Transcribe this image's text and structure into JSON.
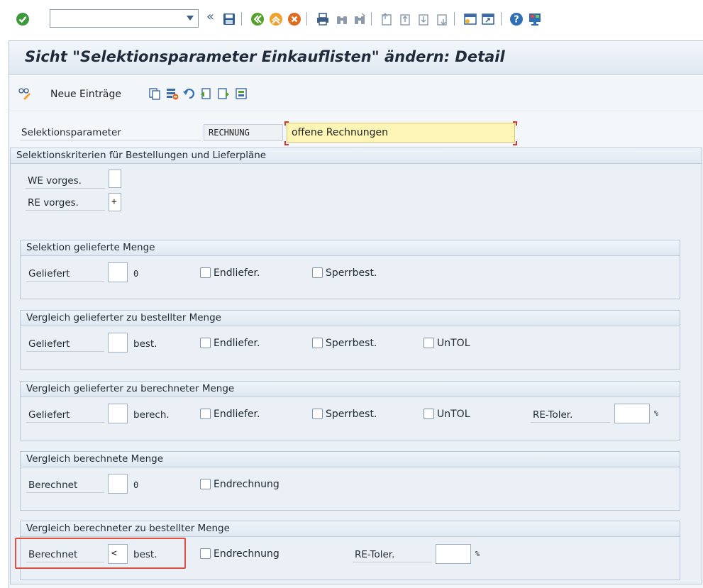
{
  "toolbar": {
    "command_value": "",
    "icons": [
      "enter-icon",
      "command-dropdown-icon",
      "collapse-icon",
      "save-icon",
      "back-icon",
      "exit-icon",
      "cancel-icon",
      "print-icon",
      "find-icon",
      "find-next-icon",
      "first-page-icon",
      "prev-page-icon",
      "next-page-icon",
      "last-page-icon",
      "new-session-icon",
      "shortcut-icon",
      "help-icon",
      "customize-layout-icon"
    ]
  },
  "title": "Sicht \"Selektionsparameter  Einkauflisten\" ändern: Detail",
  "app_toolbar": {
    "new_entries_label": "Neue Einträge",
    "icons": [
      "change-display-icon",
      "copy-as-icon",
      "delete-icon",
      "undo-icon",
      "previous-entry-icon",
      "next-entry-icon",
      "select-all-icon"
    ]
  },
  "header": {
    "selparam_label": "Selektionsparameter",
    "selparam_code": "RECHNUNG",
    "selparam_text": "offene Rechnungen"
  },
  "main_group": {
    "title": "Selektionskriterien für Bestellungen und Lieferpläne",
    "we_label": "WE vorges.",
    "we_value": "",
    "re_label": "RE vorges.",
    "re_value": "+"
  },
  "groups": {
    "g1": {
      "title": "Selektion gelieferte Menge",
      "label": "Geliefert",
      "op": "",
      "text": "0",
      "cb1": "Endliefer.",
      "cb2": "Sperrbest."
    },
    "g2": {
      "title": "Vergleich gelieferter zu bestellter Menge",
      "label": "Geliefert",
      "op": "",
      "text": "best.",
      "cb1": "Endliefer.",
      "cb2": "Sperrbest.",
      "cb3": "UnTOL"
    },
    "g3": {
      "title": "Vergleich gelieferter zu berechneter Menge",
      "label": "Geliefert",
      "op": "",
      "text": "berech.",
      "cb1": "Endliefer.",
      "cb2": "Sperrbest.",
      "cb3": "UnTOL",
      "tol_label": "RE-Toler.",
      "tol_value": "",
      "pct": "%"
    },
    "g4": {
      "title": "Vergleich berechnete Menge",
      "label": "Berechnet",
      "op": "",
      "text": "0",
      "cb1": "Endrechnung"
    },
    "g5": {
      "title": "Vergleich berechneter zu bestellter Menge",
      "label": "Berechnet",
      "op": "<",
      "text": "best.",
      "cb1": "Endrechnung",
      "tol_label": "RE-Toler.",
      "tol_value": "",
      "pct": "%"
    }
  },
  "colors": {
    "accent": "#e0503f",
    "required_field": "#fdf5b6",
    "panel": "#eaf0f6"
  }
}
